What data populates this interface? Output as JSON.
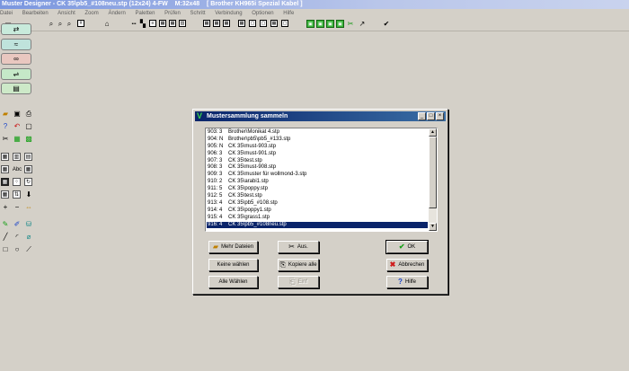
{
  "app": {
    "title": "Muster Designer - CK 35\\pb5_#108neu.stp (12x24) 4-FW",
    "grid": "M:32x48",
    "machine": "[ Brother KH965i Spezial Kabel ]"
  },
  "menu": [
    "Datei",
    "Bearbeiten",
    "Ansicht",
    "Zoom",
    "Ändern",
    "Paletten",
    "Prüfen",
    "Schritt",
    "Verbindung",
    "Optionen",
    "Hilfe"
  ],
  "toolbar_icons": [
    "new-icon",
    "zoom-in-icon",
    "zoom-out-icon",
    "zoom-icon",
    "grid-icon",
    "pattern-1-icon",
    "pattern-2-icon",
    "pattern-3-icon",
    "row-icon",
    "table-icon",
    "view-1-icon",
    "view-2-icon",
    "view-3-icon",
    "view-4-icon",
    "view-5-icon",
    "view-6-icon",
    "view-7-icon",
    "view-8-icon",
    "mode-1-icon",
    "mode-2-icon",
    "mode-3-icon",
    "mode-4-icon",
    "mode-5-icon",
    "mode-6-icon",
    "check-icon"
  ],
  "dialog": {
    "title": "Mustersammlung sammeln",
    "items": [
      {
        "num": "903:",
        "k": "3",
        "name": "Brother\\Monikat 4.stp"
      },
      {
        "num": "904:",
        "k": "N",
        "name": "Brother\\pb5\\pb5_#133.stp"
      },
      {
        "num": "905:",
        "k": "N",
        "name": "CK 35\\must-903.stp"
      },
      {
        "num": "906:",
        "k": "3",
        "name": "CK 35\\must-901.stp"
      },
      {
        "num": "907:",
        "k": "3",
        "name": "CK 35\\test.stp"
      },
      {
        "num": "908:",
        "k": "3",
        "name": "CK 35\\must-908.stp"
      },
      {
        "num": "909:",
        "k": "3",
        "name": "CK 35\\muster für wollmond-3.stp"
      },
      {
        "num": "910:",
        "k": "2",
        "name": "CK 35\\arabi1.stp"
      },
      {
        "num": "911:",
        "k": "5",
        "name": "CK 35\\poppy.stp"
      },
      {
        "num": "912:",
        "k": "5",
        "name": "CK 35\\test.stp"
      },
      {
        "num": "913:",
        "k": "4",
        "name": "CK 35\\pb5_#108.stp"
      },
      {
        "num": "914:",
        "k": "4",
        "name": "CK 35\\poppy1.stp"
      },
      {
        "num": "915:",
        "k": "4",
        "name": "CK 35\\grass1.stp"
      },
      {
        "num": "916:",
        "k": "4",
        "name": "CK 35\\pb5_#108neu.stp"
      }
    ],
    "selected_index": 13,
    "buttons": {
      "mehr_dateien": "Mehr Dateien",
      "keine_waehlen": "Keine wählen",
      "alle_waehlen": "Alle Wählen",
      "aus": "Aus.",
      "kopiere_alle": "Kopiere alle",
      "einf": "Einf",
      "ok": "OK",
      "abbrechen": "Abbrechen",
      "hilfe": "Hilfe"
    }
  }
}
